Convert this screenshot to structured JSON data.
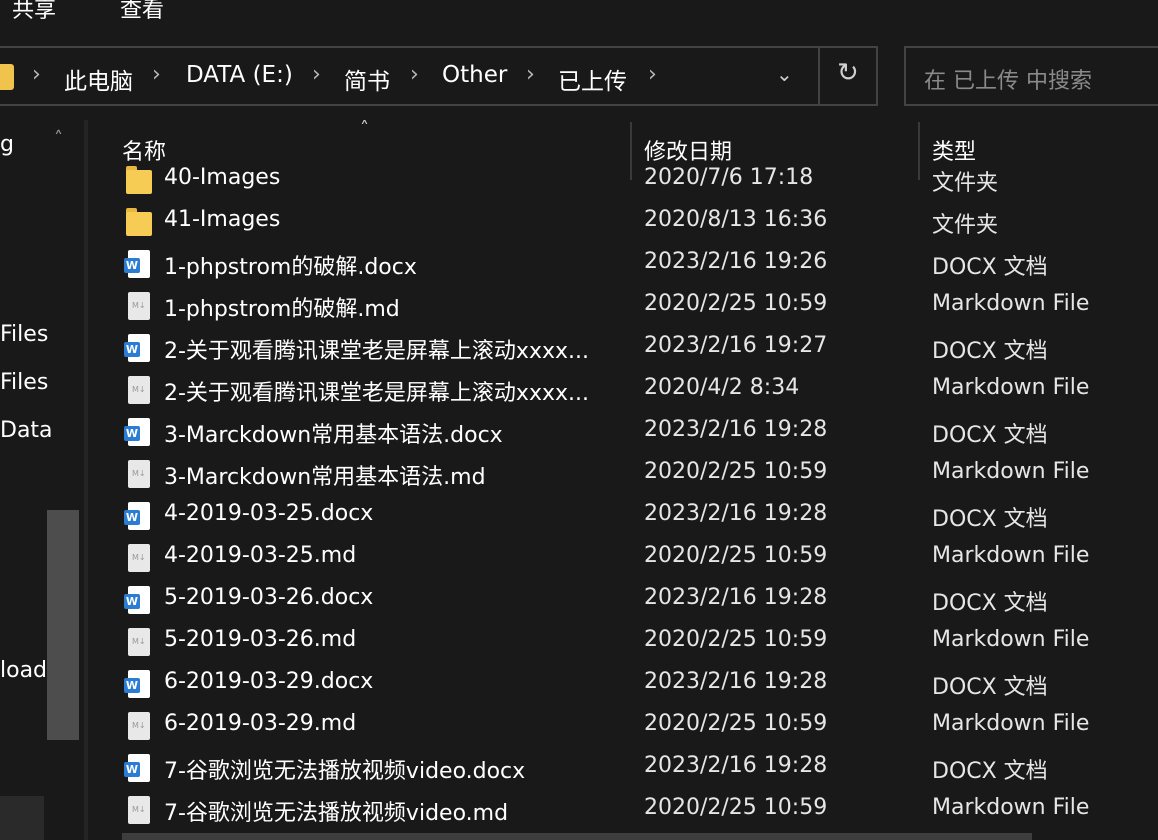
{
  "ribbon": {
    "tabs": [
      "共享",
      "查看"
    ]
  },
  "address_bar": {
    "breadcrumbs": [
      "此电脑",
      "DATA (E:)",
      "简书",
      "Other",
      "已上传"
    ],
    "separator": "›",
    "dropdown_icon": "chevron-down-icon",
    "refresh_icon": "refresh-icon"
  },
  "search": {
    "placeholder": "在 已上传 中搜索"
  },
  "nav_pane": {
    "items": [
      "g",
      "Files",
      "Files",
      "Data",
      "load"
    ]
  },
  "columns": {
    "name": "名称",
    "date": "修改日期",
    "type": "类型"
  },
  "files": [
    {
      "name": "40-Images",
      "date": "2020/7/6 17:18",
      "type": "文件夹",
      "icon": "folder"
    },
    {
      "name": "41-Images",
      "date": "2020/8/13 16:36",
      "type": "文件夹",
      "icon": "folder"
    },
    {
      "name": "1-phpstrom的破解.docx",
      "date": "2023/2/16 19:26",
      "type": "DOCX 文档",
      "icon": "docx"
    },
    {
      "name": "1-phpstrom的破解.md",
      "date": "2020/2/25 10:59",
      "type": "Markdown File",
      "icon": "md"
    },
    {
      "name": "2-关于观看腾讯课堂老是屏幕上滚动xxxx...",
      "date": "2023/2/16 19:27",
      "type": "DOCX 文档",
      "icon": "docx"
    },
    {
      "name": "2-关于观看腾讯课堂老是屏幕上滚动xxxx...",
      "date": "2020/4/2 8:34",
      "type": "Markdown File",
      "icon": "md"
    },
    {
      "name": "3-Marckdown常用基本语法.docx",
      "date": "2023/2/16 19:28",
      "type": "DOCX 文档",
      "icon": "docx"
    },
    {
      "name": "3-Marckdown常用基本语法.md",
      "date": "2020/2/25 10:59",
      "type": "Markdown File",
      "icon": "md"
    },
    {
      "name": "4-2019-03-25.docx",
      "date": "2023/2/16 19:28",
      "type": "DOCX 文档",
      "icon": "docx"
    },
    {
      "name": "4-2019-03-25.md",
      "date": "2020/2/25 10:59",
      "type": "Markdown File",
      "icon": "md"
    },
    {
      "name": "5-2019-03-26.docx",
      "date": "2023/2/16 19:28",
      "type": "DOCX 文档",
      "icon": "docx"
    },
    {
      "name": "5-2019-03-26.md",
      "date": "2020/2/25 10:59",
      "type": "Markdown File",
      "icon": "md"
    },
    {
      "name": "6-2019-03-29.docx",
      "date": "2023/2/16 19:28",
      "type": "DOCX 文档",
      "icon": "docx"
    },
    {
      "name": "6-2019-03-29.md",
      "date": "2020/2/25 10:59",
      "type": "Markdown File",
      "icon": "md"
    },
    {
      "name": "7-谷歌浏览无法播放视频video.docx",
      "date": "2023/2/16 19:28",
      "type": "DOCX 文档",
      "icon": "docx"
    },
    {
      "name": "7-谷歌浏览无法播放视频video.md",
      "date": "2020/2/25 10:59",
      "type": "Markdown File",
      "icon": "md"
    }
  ],
  "colors": {
    "background": "#191919",
    "border": "#434343",
    "folder": "#f7cc55",
    "word_blue": "#2b7cd3"
  }
}
